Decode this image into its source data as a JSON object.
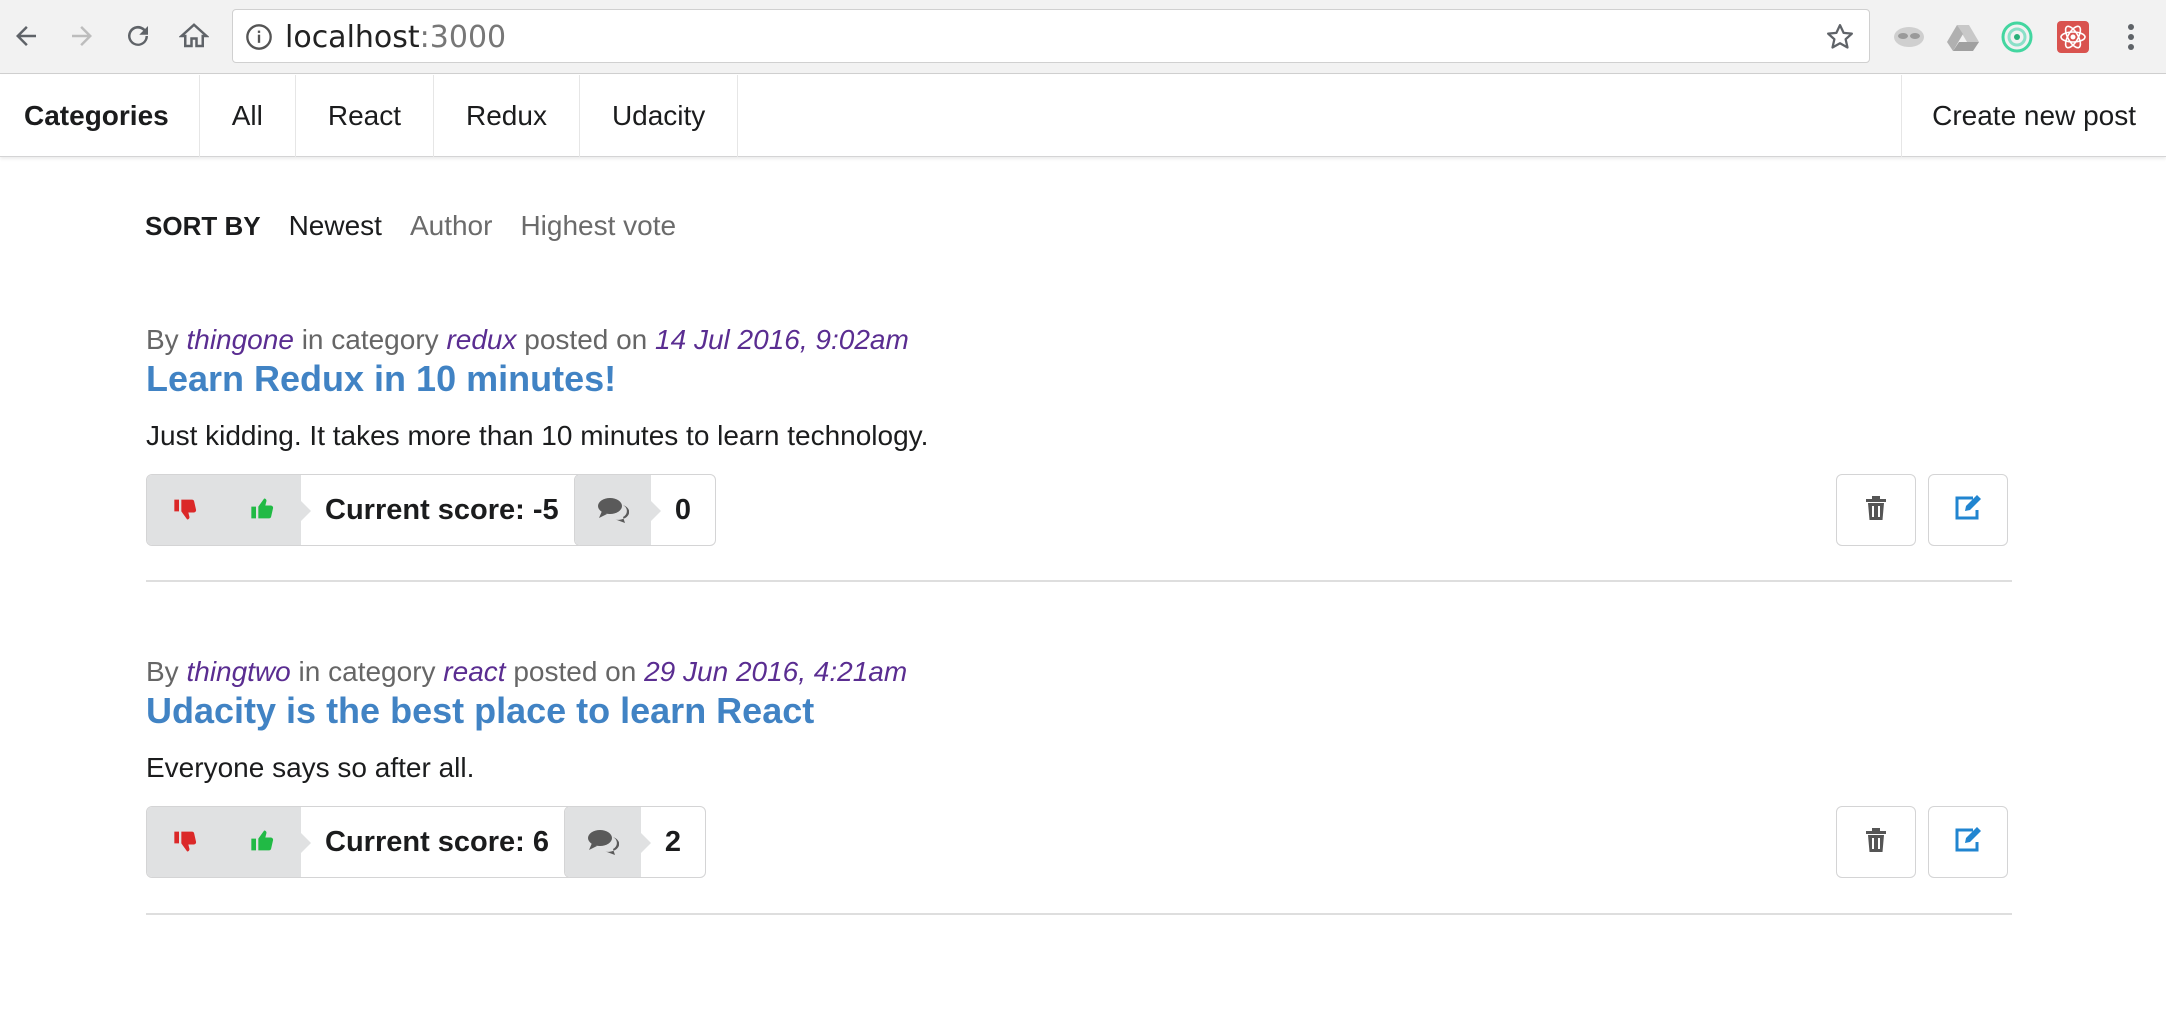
{
  "browser": {
    "url_host": "localhost",
    "url_port": ":3000"
  },
  "nav": {
    "header": "Categories",
    "items": [
      "All",
      "React",
      "Redux",
      "Udacity"
    ],
    "create_label": "Create new post"
  },
  "sort": {
    "label": "SORT BY",
    "options": [
      "Newest",
      "Author",
      "Highest vote"
    ],
    "active": "Newest"
  },
  "posts": [
    {
      "by_label": "By",
      "author": "thingone",
      "category_label": "in category",
      "category": "redux",
      "posted_label": "posted on",
      "date": "14 Jul 2016, 9:02am",
      "title": "Learn Redux in 10 minutes!",
      "body": "Just kidding. It takes more than 10 minutes to learn technology.",
      "score_text": "Current score: -5",
      "comment_count": "0"
    },
    {
      "by_label": "By",
      "author": "thingtwo",
      "category_label": "in category",
      "category": "react",
      "posted_label": "posted on",
      "date": "29 Jun 2016, 4:21am",
      "title": "Udacity is the best place to learn React",
      "body": "Everyone says so after all.",
      "score_text": "Current score: 6",
      "comment_count": "2"
    }
  ],
  "icons": {
    "downvote": "thumbs-down-icon",
    "upvote": "thumbs-up-icon",
    "comments": "comments-icon",
    "delete": "trash-icon",
    "edit": "edit-icon"
  },
  "colors": {
    "downvote": "#db2828",
    "upvote": "#21ba45",
    "title": "#4183c4",
    "meta_highlight": "#5a2d91",
    "edit": "#2185d0"
  }
}
